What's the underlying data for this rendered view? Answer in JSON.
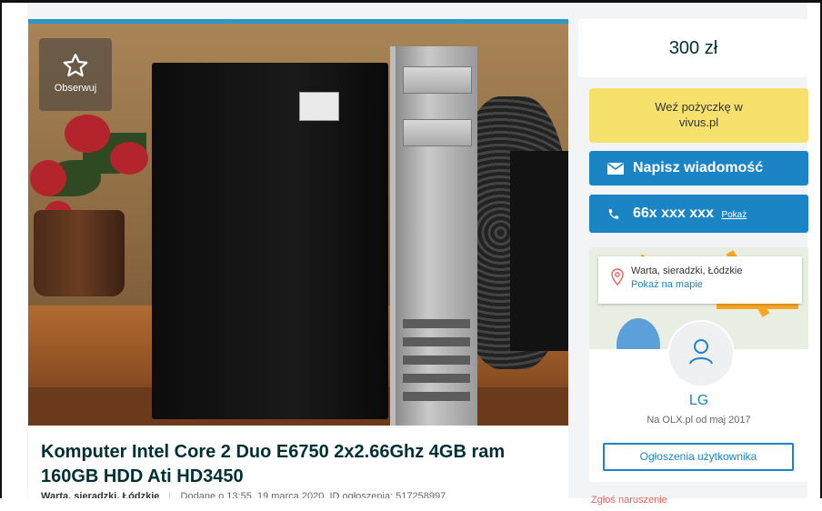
{
  "listing": {
    "observe_label": "Obserwuj",
    "title": "Komputer Intel Core 2 Duo E6750 2x2.66Ghz 4GB ram 160GB HDD Ati HD3450",
    "location": "Warta, sieradzki, Łódzkie",
    "added_info": "Dodane o 13:55, 19 marca 2020, ID ogłoszenia: 517258997"
  },
  "sidebar": {
    "price": "300 zł",
    "loan_line1": "Weź pożyczkę w",
    "loan_line2": "vivus.pl",
    "message_label": "Napisz wiadomość",
    "phone_number": "66x xxx xxx",
    "phone_show": "Pokaż",
    "seller": {
      "location": "Warta, sieradzki, Łódzkie",
      "map_link": "Pokaż na mapie",
      "name": "LG",
      "since": "Na OLX.pl od maj 2017",
      "ads_button": "Ogłoszenia użytkownika"
    },
    "report_link": "Zgłoś naruszenie"
  },
  "colors": {
    "accent_blue": "#1a84c4",
    "loan_yellow": "#f7e16d",
    "report_red": "#e8625a"
  },
  "icons": [
    "star-icon",
    "envelope-icon",
    "phone-icon",
    "map-pin-icon",
    "user-icon"
  ]
}
